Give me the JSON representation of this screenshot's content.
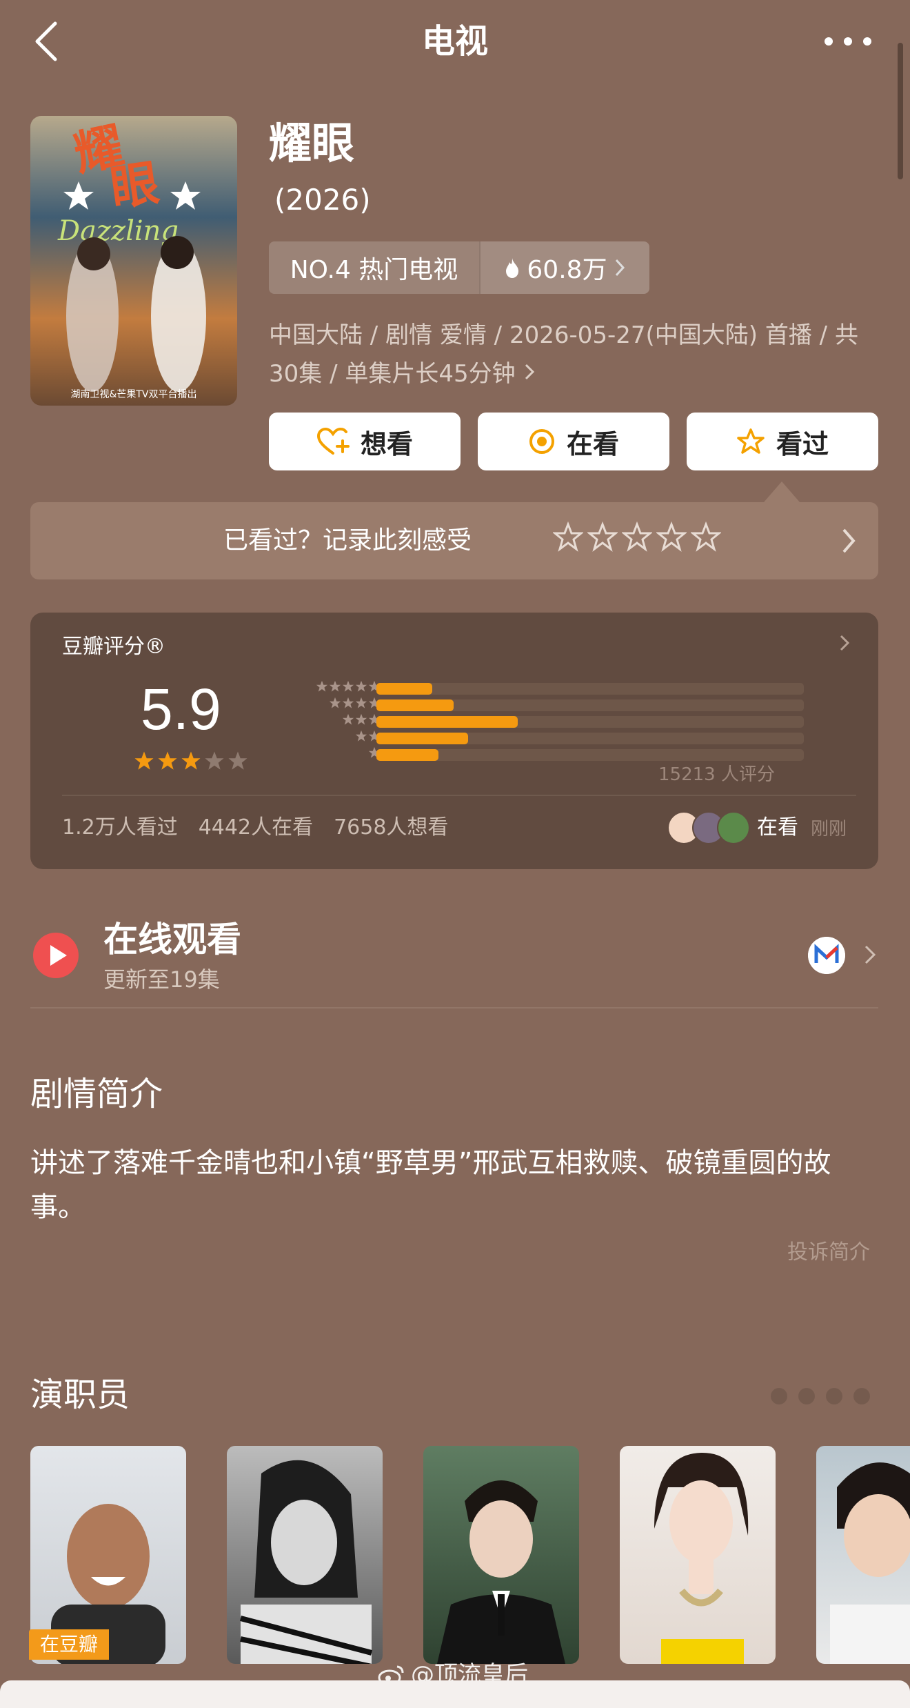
{
  "header": {
    "title": "电视",
    "back_icon": "chevron-left-icon",
    "more_icon": "ellipsis-icon"
  },
  "poster": {
    "caption": "Dazzling",
    "sub_caption": "湖南卫视&芒果TV双平台播出"
  },
  "movie": {
    "title": "耀眼",
    "year": "(2026)",
    "rank": "NO.4 热门电视",
    "heat": "60.8万",
    "meta": "中国大陆 / 剧情 爱情 / 2026-05-27(中国大陆) 首播 / 共30集 / 单集片长45分钟"
  },
  "actions": {
    "want": "想看",
    "watching": "在看",
    "watched": "看过"
  },
  "rate_prompt": "已看过？记录此刻感受",
  "score": {
    "label": "豆瓣评分®",
    "value": "5.9",
    "stars_filled": 3,
    "stars_total": 5,
    "distribution": [
      {
        "stars": 5,
        "fraction": 0.13
      },
      {
        "stars": 4,
        "fraction": 0.18
      },
      {
        "stars": 3,
        "fraction": 0.33
      },
      {
        "stars": 2,
        "fraction": 0.215
      },
      {
        "stars": 1,
        "fraction": 0.145
      }
    ],
    "count": "15213 人评分",
    "stats": [
      "1.2万人看过",
      "4442人在看",
      "7658人想看"
    ],
    "now_watching": "在看",
    "just_now": "刚刚"
  },
  "online": {
    "title": "在线观看",
    "subtitle": "更新至19集"
  },
  "synopsis": {
    "title": "剧情简介",
    "body": "讲述了落难千金晴也和小镇“野草男”邢武互相救赎、破镜重圆的故事。",
    "report": "投诉简介"
  },
  "cast": {
    "title": "演职员",
    "badge": "在豆瓣"
  },
  "watermark": "@顶流皇后",
  "colors": {
    "background": "#86685a",
    "card": "#614b40",
    "accent": "#f59a10"
  }
}
